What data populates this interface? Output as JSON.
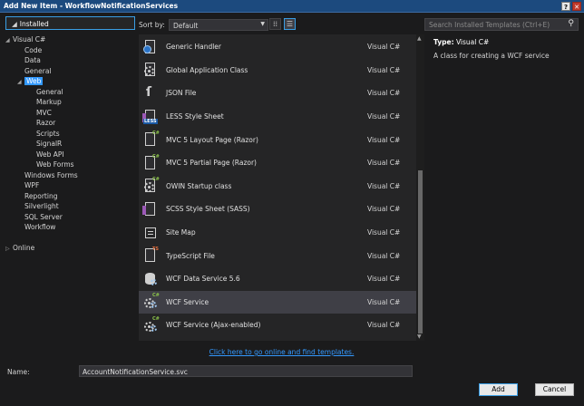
{
  "window": {
    "title": "Add New Item - WorkflowNotificationServices",
    "help_btn": "?",
    "close_btn": "✕"
  },
  "left": {
    "header": "Installed",
    "tree": [
      {
        "label": "Visual C#",
        "indent": 0,
        "expander": "◢",
        "selected": false
      },
      {
        "label": "Code",
        "indent": 1,
        "expander": "",
        "selected": false
      },
      {
        "label": "Data",
        "indent": 1,
        "expander": "",
        "selected": false
      },
      {
        "label": "General",
        "indent": 1,
        "expander": "",
        "selected": false
      },
      {
        "label": "Web",
        "indent": 1,
        "expander": "◢",
        "selected": true
      },
      {
        "label": "General",
        "indent": 2,
        "expander": "",
        "selected": false
      },
      {
        "label": "Markup",
        "indent": 2,
        "expander": "",
        "selected": false
      },
      {
        "label": "MVC",
        "indent": 2,
        "expander": "",
        "selected": false
      },
      {
        "label": "Razor",
        "indent": 2,
        "expander": "",
        "selected": false
      },
      {
        "label": "Scripts",
        "indent": 2,
        "expander": "",
        "selected": false
      },
      {
        "label": "SignalR",
        "indent": 2,
        "expander": "",
        "selected": false
      },
      {
        "label": "Web API",
        "indent": 2,
        "expander": "",
        "selected": false
      },
      {
        "label": "Web Forms",
        "indent": 2,
        "expander": "",
        "selected": false
      },
      {
        "label": "Windows Forms",
        "indent": 1,
        "expander": "",
        "selected": false
      },
      {
        "label": "WPF",
        "indent": 1,
        "expander": "",
        "selected": false
      },
      {
        "label": "Reporting",
        "indent": 1,
        "expander": "",
        "selected": false
      },
      {
        "label": "Silverlight",
        "indent": 1,
        "expander": "",
        "selected": false
      },
      {
        "label": "SQL Server",
        "indent": 1,
        "expander": "",
        "selected": false
      },
      {
        "label": "Workflow",
        "indent": 1,
        "expander": "",
        "selected": false
      },
      {
        "label": "",
        "indent": 0,
        "expander": "",
        "selected": false
      },
      {
        "label": "Online",
        "indent": 0,
        "expander": "▷",
        "selected": false
      }
    ]
  },
  "sortbar": {
    "label": "Sort by:",
    "value": "Default"
  },
  "search": {
    "placeholder": "Search Installed Templates (Ctrl+E)"
  },
  "templates": [
    {
      "name": "Generic Handler",
      "lang": "Visual C#",
      "icon": "generic-handler-icon",
      "selected": false
    },
    {
      "name": "Global Application Class",
      "lang": "Visual C#",
      "icon": "global-application-class-icon",
      "selected": false
    },
    {
      "name": "JSON File",
      "lang": "Visual C#",
      "icon": "json-file-icon",
      "selected": false
    },
    {
      "name": "LESS Style Sheet",
      "lang": "Visual C#",
      "icon": "less-stylesheet-icon",
      "selected": false
    },
    {
      "name": "MVC 5 Layout Page (Razor)",
      "lang": "Visual C#",
      "icon": "razor-layout-icon",
      "selected": false
    },
    {
      "name": "MVC 5 Partial Page (Razor)",
      "lang": "Visual C#",
      "icon": "razor-partial-icon",
      "selected": false
    },
    {
      "name": "OWIN Startup class",
      "lang": "Visual C#",
      "icon": "owin-startup-icon",
      "selected": false
    },
    {
      "name": "SCSS Style Sheet (SASS)",
      "lang": "Visual C#",
      "icon": "scss-stylesheet-icon",
      "selected": false
    },
    {
      "name": "Site Map",
      "lang": "Visual C#",
      "icon": "site-map-icon",
      "selected": false
    },
    {
      "name": "TypeScript File",
      "lang": "Visual C#",
      "icon": "typescript-file-icon",
      "selected": false
    },
    {
      "name": "WCF Data Service 5.6",
      "lang": "Visual C#",
      "icon": "wcf-data-service-icon",
      "selected": false
    },
    {
      "name": "WCF Service",
      "lang": "Visual C#",
      "icon": "wcf-service-icon",
      "selected": true
    },
    {
      "name": "WCF Service (Ajax-enabled)",
      "lang": "Visual C#",
      "icon": "wcf-ajax-service-icon",
      "selected": false
    }
  ],
  "online_link": "Click here to go online and find templates.",
  "details": {
    "type_label": "Type:",
    "type_value": "Visual C#",
    "description": "A class for creating a WCF service"
  },
  "bottom": {
    "name_label": "Name:",
    "name_value": "AccountNotificationService.svc",
    "add_label": "Add",
    "cancel_label": "Cancel"
  },
  "colors": {
    "accent": "#3399ff",
    "titlebar": "#1c4a7e",
    "background": "#1b1b1c",
    "selection": "#3f3f46"
  }
}
